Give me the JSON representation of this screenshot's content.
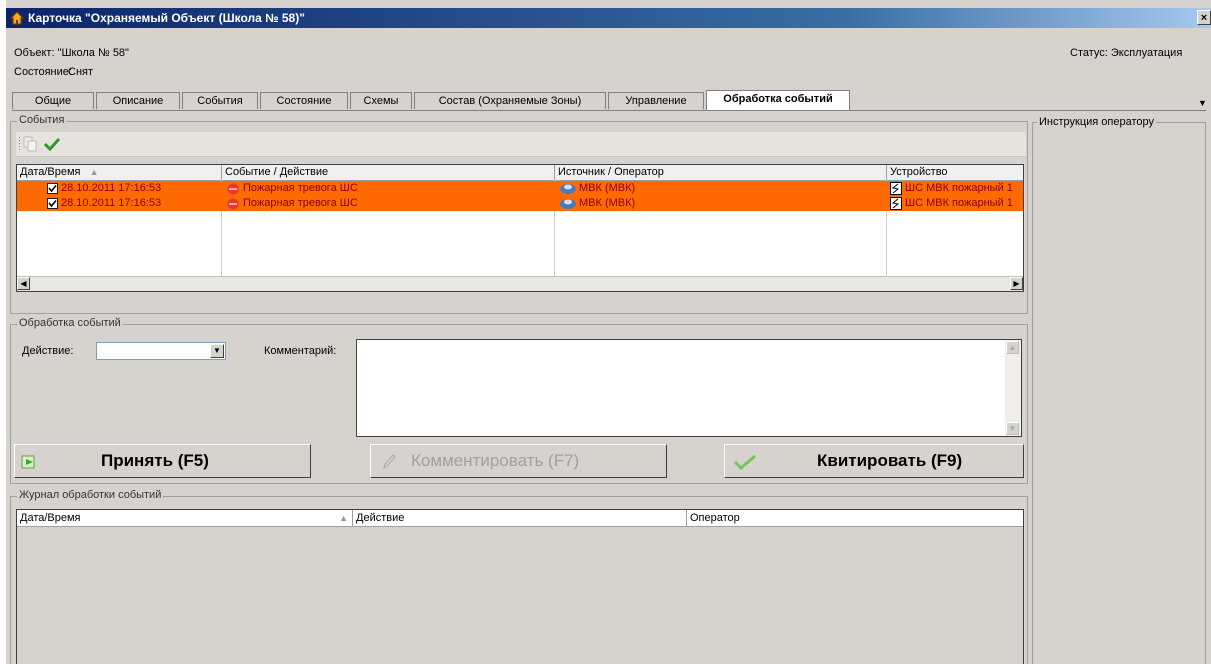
{
  "window": {
    "title": "Карточка \"Охраняемый Объект (Школа № 58)\"",
    "close_glyph": "×"
  },
  "header": {
    "object_label": "Объект: \"Школа № 58\"",
    "state_label": "Состояние:",
    "state_value": "Снят",
    "status": "Статус: Эксплуатация"
  },
  "tabs": [
    {
      "label": "Общие"
    },
    {
      "label": "Описание"
    },
    {
      "label": "События"
    },
    {
      "label": "Состояние"
    },
    {
      "label": "Схемы"
    },
    {
      "label": "Состав (Охраняемые Зоны)"
    },
    {
      "label": "Управление"
    },
    {
      "label": "Обработка событий",
      "active": true
    }
  ],
  "events": {
    "group_title": "События",
    "columns": [
      "Дата/Время",
      "Событие / Действие",
      "Источник / Оператор",
      "Устройство"
    ],
    "rows": [
      {
        "datetime": "28.10.2011 17:16:53",
        "event": "Пожарная тревога ШС",
        "source": "МВК (МВК)",
        "device": "ШС МВК пожарный 1",
        "checked": true
      },
      {
        "datetime": "28.10.2011 17:16:53",
        "event": "Пожарная тревога ШС",
        "source": "МВК (МВК)",
        "device": "ШС МВК пожарный 1",
        "checked": true
      }
    ],
    "row_color": "#ff6a00"
  },
  "processing": {
    "group_title": "Обработка событий",
    "action_label": "Действие:",
    "action_value": "",
    "comment_label": "Комментарий:",
    "comment_value": ""
  },
  "buttons": {
    "accept": "Принять (F5)",
    "comment": "Комментировать (F7)",
    "ack": "Квитировать (F9)"
  },
  "journal": {
    "group_title": "Журнал обработки событий",
    "columns": [
      "Дата/Время",
      "Действие",
      "Оператор"
    ]
  },
  "instructions": {
    "title": "Инструкция оператору"
  }
}
